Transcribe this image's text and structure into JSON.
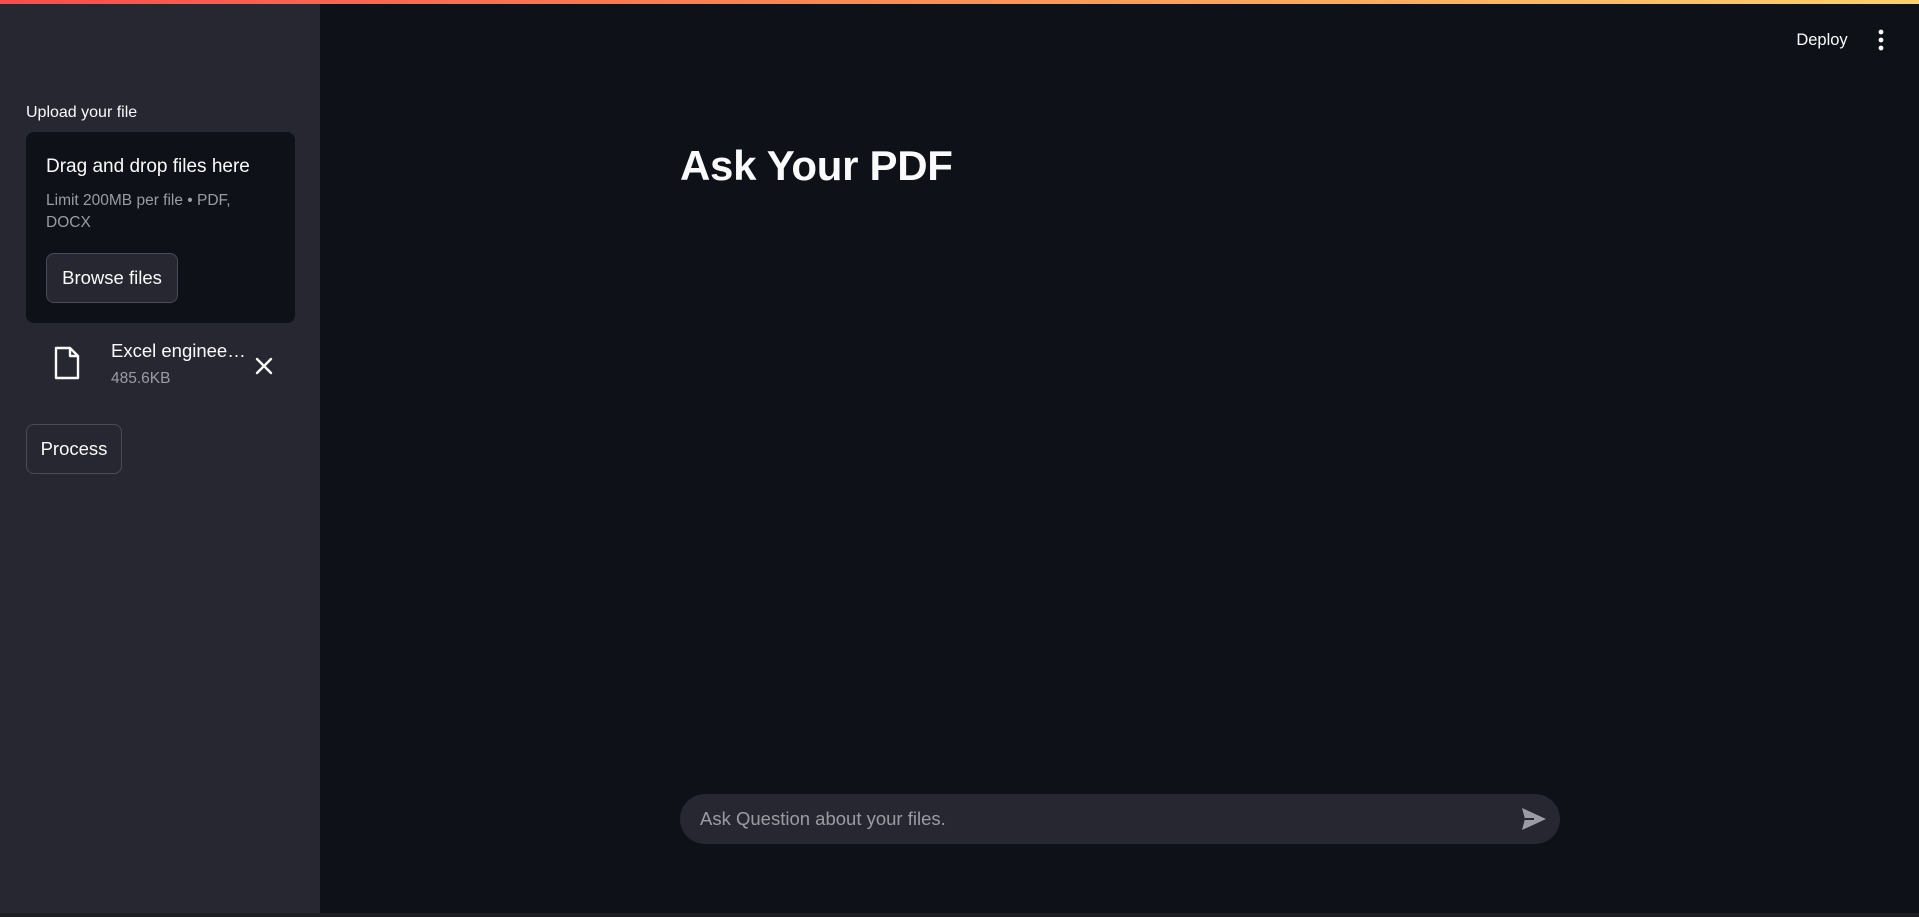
{
  "header": {
    "deploy_label": "Deploy",
    "menu_icon": "more-vertical-icon"
  },
  "sidebar": {
    "upload_label": "Upload your file",
    "dropzone": {
      "title": "Drag and drop files here",
      "limit_text": "Limit 200MB per file • PDF, DOCX",
      "browse_label": "Browse files"
    },
    "uploaded_file": {
      "name": "Excel engineering project.pdf",
      "size": "485.6KB",
      "icon": "file-icon",
      "remove_icon": "close-icon"
    },
    "process_label": "Process"
  },
  "main": {
    "title": "Ask Your PDF",
    "chat_input": {
      "placeholder": "Ask Question about your files.",
      "value": "",
      "send_icon": "send-icon"
    }
  },
  "colors": {
    "background": "#0e1117",
    "sidebar": "#262730",
    "text": "#fafafa",
    "muted_text": "#9b9ca3",
    "accent_gradient_start": "#ff4b4b",
    "accent_gradient_end": "#ffd166"
  }
}
